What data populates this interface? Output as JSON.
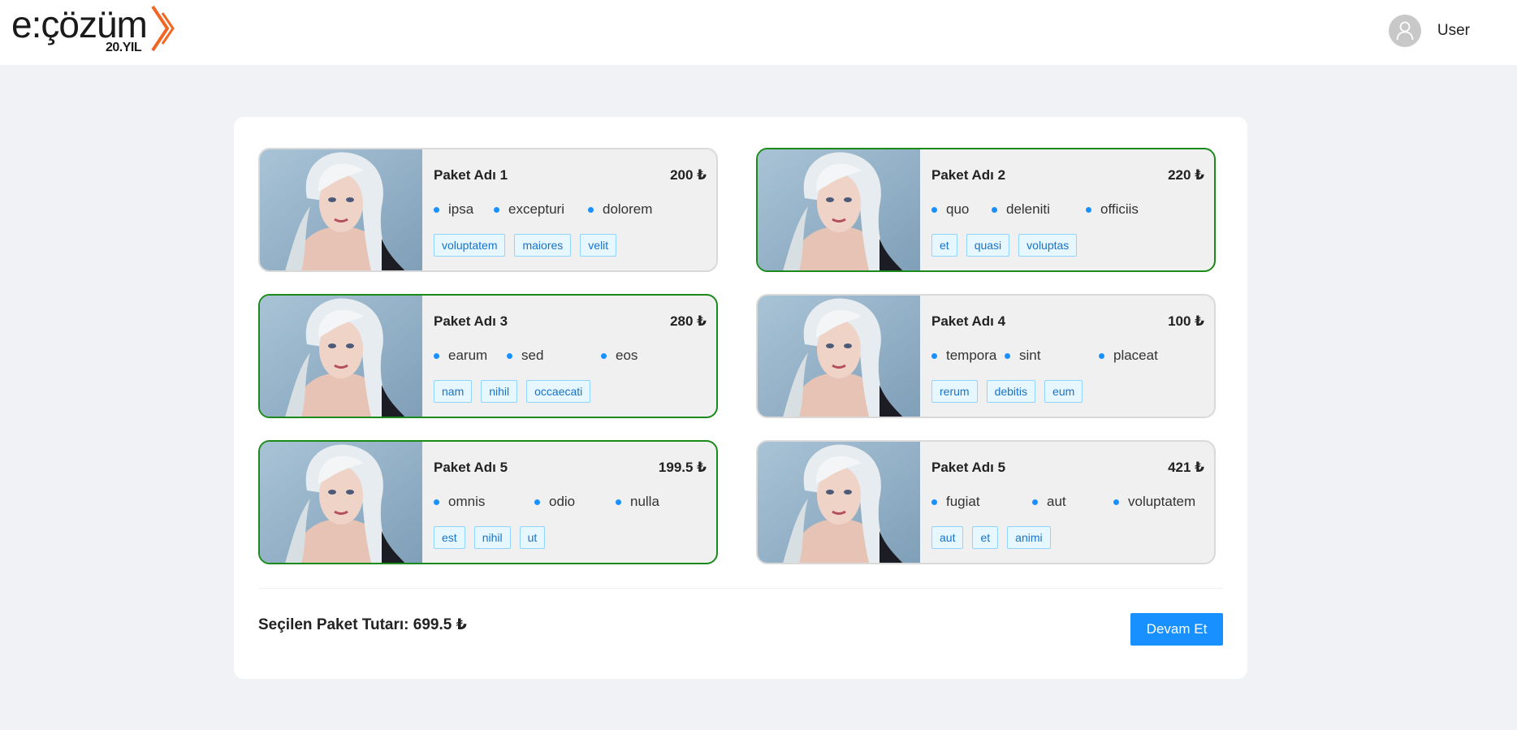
{
  "header": {
    "logo_text": "e:çözüm",
    "logo_sub": "20.YIL",
    "user_label": "User"
  },
  "colors": {
    "accent": "#1890ff",
    "selected_border": "#1a8a1a",
    "brand_orange": "#f26522"
  },
  "packages": [
    {
      "title": "Paket Adı 1",
      "price": "200 ₺",
      "selected": false,
      "features": [
        "ipsa",
        "excepturi",
        "dolorem"
      ],
      "tags": [
        "voluptatem",
        "maiores",
        "velit"
      ]
    },
    {
      "title": "Paket Adı 2",
      "price": "220 ₺",
      "selected": true,
      "features": [
        "quo",
        "deleniti",
        "officiis"
      ],
      "tags": [
        "et",
        "quasi",
        "voluptas"
      ]
    },
    {
      "title": "Paket Adı 3",
      "price": "280 ₺",
      "selected": true,
      "features": [
        "earum",
        "sed",
        "eos"
      ],
      "tags": [
        "nam",
        "nihil",
        "occaecati"
      ]
    },
    {
      "title": "Paket Adı 4",
      "price": "100 ₺",
      "selected": false,
      "features": [
        "tempora",
        "sint",
        "placeat"
      ],
      "tags": [
        "rerum",
        "debitis",
        "eum"
      ]
    },
    {
      "title": "Paket Adı 5",
      "price": "199.5 ₺",
      "selected": true,
      "features": [
        "omnis",
        "odio",
        "nulla"
      ],
      "tags": [
        "est",
        "nihil",
        "ut"
      ]
    },
    {
      "title": "Paket Adı 5",
      "price": "421 ₺",
      "selected": false,
      "features": [
        "fugiat",
        "aut",
        "voluptatem"
      ],
      "tags": [
        "aut",
        "et",
        "animi"
      ]
    }
  ],
  "footer": {
    "total_text": "Seçilen Paket Tutarı: 699.5 ₺",
    "continue_label": "Devam Et"
  }
}
